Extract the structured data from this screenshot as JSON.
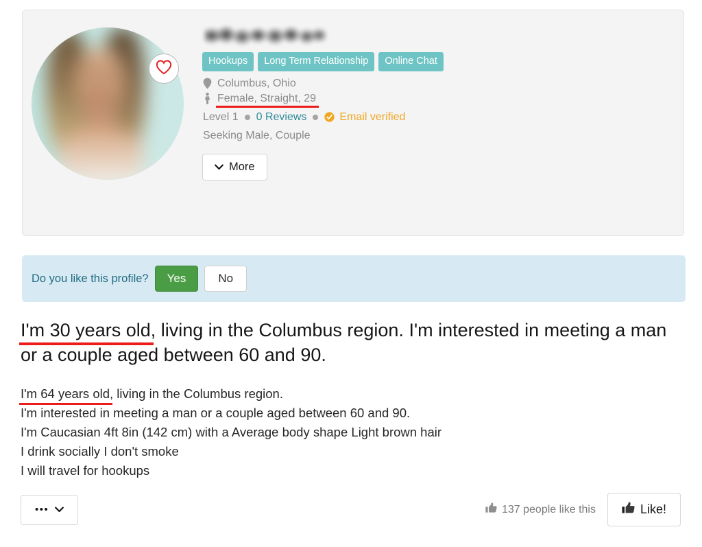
{
  "profile": {
    "username_redacted": true,
    "avatar_alt": "blurred-profile-photo",
    "favorite_icon": "heart-icon",
    "tags": [
      "Hookups",
      "Long Term Relationship",
      "Online Chat"
    ],
    "location_icon": "map-pin-icon",
    "location": "Columbus, Ohio",
    "gender_icon": "person-icon",
    "gender_line": "Female, Straight, 29",
    "level": "Level 1",
    "reviews": "0 Reviews",
    "verified_icon": "check-circle-icon",
    "verified": "Email verified",
    "seeking": "Seeking Male, Couple",
    "more_label": "More",
    "more_icon": "chevron-down-icon"
  },
  "prompt": {
    "question": "Do you like this profile?",
    "yes_label": "Yes",
    "no_label": "No"
  },
  "headline": {
    "highlight": "I'm 30 years old",
    "rest": ", living in the Columbus region. I'm interested in meeting a man or a couple aged between 60 and 90."
  },
  "bio": {
    "line1_highlight": "I'm 64 years old",
    "line1_rest": ", living in the Columbus region.",
    "line2": "I'm interested in meeting a man or a couple aged between 60 and 90.",
    "line3": "I'm Caucasian 4ft 8in (142 cm) with a Average body shape Light brown hair",
    "line4": "I drink socially I don't smoke",
    "line5": "I will travel for hookups"
  },
  "footer": {
    "menu_dots": "•••",
    "menu_icon": "chevron-down-icon",
    "like_count_icon": "thumbs-up-icon",
    "like_count": "137 people like this",
    "like_label": "Like!",
    "like_icon": "thumbs-up-icon"
  },
  "colors": {
    "tag_teal": "#6ec4c4",
    "link_teal": "#2f8a99",
    "verified_orange": "#f0a823",
    "yes_green": "#4a9d44",
    "prompt_blue": "#d7eaf4",
    "underline_red": "#ee1b1b"
  }
}
